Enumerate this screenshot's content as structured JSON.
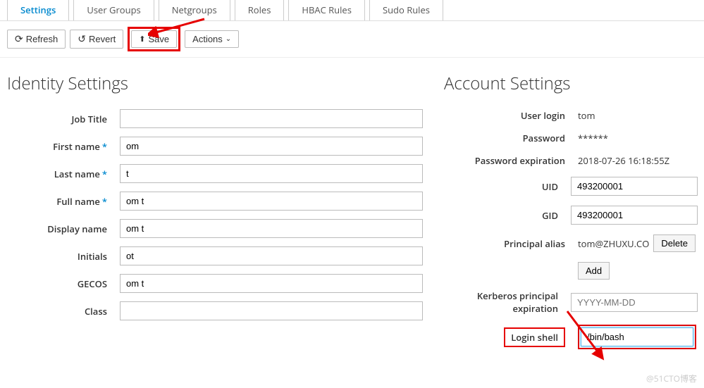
{
  "tabs": [
    {
      "label": "Settings",
      "active": true
    },
    {
      "label": "User Groups"
    },
    {
      "label": "Netgroups"
    },
    {
      "label": "Roles"
    },
    {
      "label": "HBAC Rules"
    },
    {
      "label": "Sudo Rules"
    }
  ],
  "toolbar": {
    "refresh": "Refresh",
    "revert": "Revert",
    "save": "Save",
    "actions": "Actions"
  },
  "identity": {
    "title": "Identity Settings",
    "fields": {
      "job_title": {
        "label": "Job Title",
        "value": ""
      },
      "first_name": {
        "label": "First name",
        "value": "om",
        "required": true
      },
      "last_name": {
        "label": "Last name",
        "value": "t",
        "required": true
      },
      "full_name": {
        "label": "Full name",
        "value": "om t",
        "required": true
      },
      "display_name": {
        "label": "Display name",
        "value": "om t"
      },
      "initials": {
        "label": "Initials",
        "value": "ot"
      },
      "gecos": {
        "label": "GECOS",
        "value": "om t"
      },
      "class": {
        "label": "Class",
        "value": ""
      }
    }
  },
  "account": {
    "title": "Account Settings",
    "user_login": {
      "label": "User login",
      "value": "tom"
    },
    "password": {
      "label": "Password",
      "value": "******"
    },
    "password_expiration": {
      "label": "Password expiration",
      "value": "2018-07-26 16:18:55Z"
    },
    "uid": {
      "label": "UID",
      "value": "493200001"
    },
    "gid": {
      "label": "GID",
      "value": "493200001"
    },
    "principal_alias": {
      "label": "Principal alias",
      "value": "tom@ZHUXU.CO",
      "delete": "Delete",
      "add": "Add"
    },
    "kerberos_expiration": {
      "label": "Kerberos principal expiration",
      "placeholder": "YYYY-MM-DD",
      "value": ""
    },
    "login_shell": {
      "label": "Login shell",
      "value": "/bin/bash"
    }
  },
  "watermark": "@51CTO博客"
}
